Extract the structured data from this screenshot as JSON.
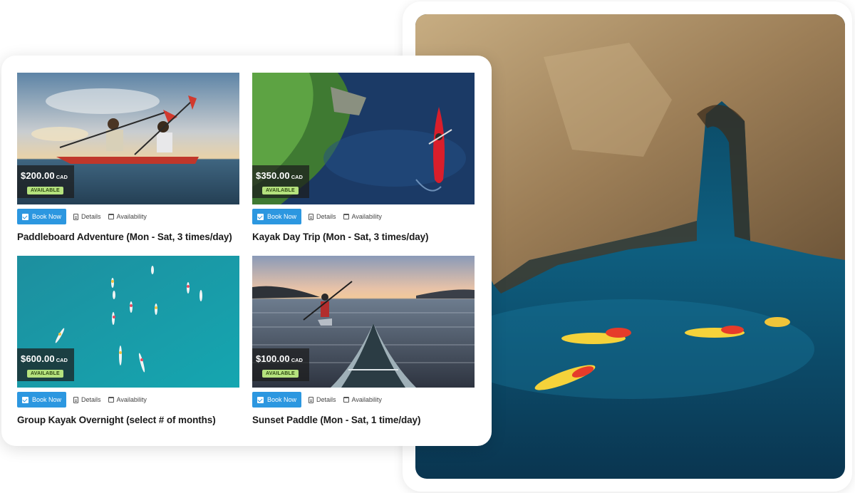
{
  "listings": [
    {
      "title": "Paddleboard Adventure (Mon - Sat, 3 times/day)",
      "price": "$200.00",
      "currency": "CAD",
      "status": "AVAILABLE",
      "book_label": "Book Now",
      "details_label": "Details",
      "availability_label": "Availability"
    },
    {
      "title": "Kayak Day Trip (Mon - Sat, 3 times/day)",
      "price": "$350.00",
      "currency": "CAD",
      "status": "AVAILABLE",
      "book_label": "Book Now",
      "details_label": "Details",
      "availability_label": "Availability"
    },
    {
      "title": "Group Kayak Overnight (select # of months)",
      "price": "$600.00",
      "currency": "CAD",
      "status": "AVAILABLE",
      "book_label": "Book Now",
      "details_label": "Details",
      "availability_label": "Availability"
    },
    {
      "title": "Sunset Paddle (Mon - Sat, 1 time/day)",
      "price": "$100.00",
      "currency": "CAD",
      "status": "AVAILABLE",
      "book_label": "Book Now",
      "details_label": "Details",
      "availability_label": "Availability"
    }
  ],
  "icons": {
    "book": "checkbox-icon",
    "details": "document-icon",
    "availability": "calendar-icon"
  },
  "colors": {
    "book_button": "#2c97e0",
    "status_badge": "#b5e27e",
    "price_overlay": "#1c1c1c"
  }
}
